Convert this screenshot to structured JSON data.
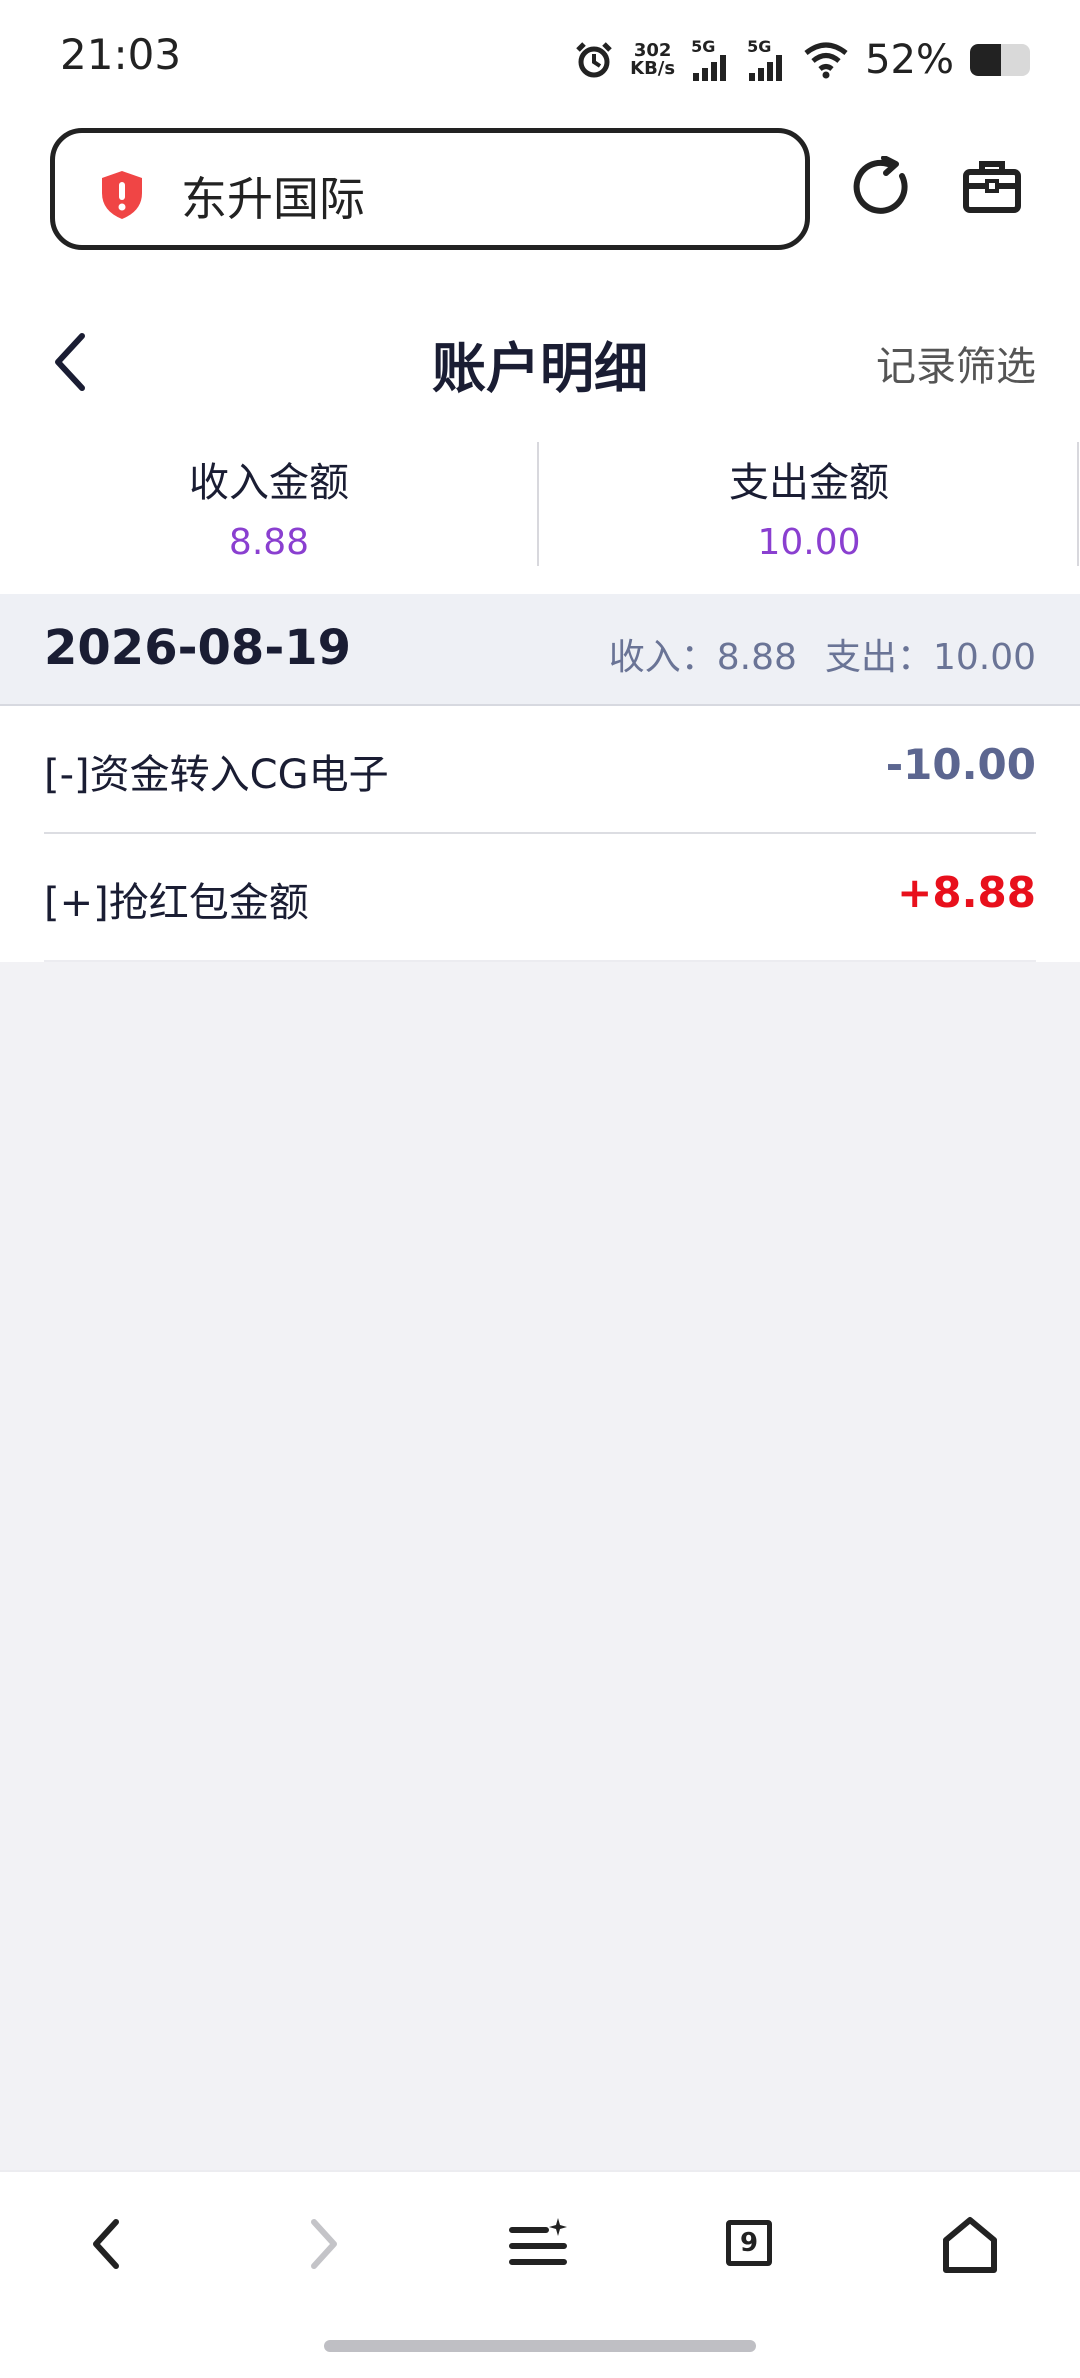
{
  "status_bar": {
    "time": "21:03",
    "net_speed_value": "302",
    "net_speed_unit": "KB/s",
    "sim1": "5G",
    "sim2": "5G",
    "battery_percent": "52%"
  },
  "browser": {
    "url_title": "东升国际",
    "icons": [
      "warning-shield-icon",
      "reload-icon",
      "toolbox-icon"
    ]
  },
  "header": {
    "title": "账户明细",
    "filter_label": "记录筛选"
  },
  "summary": {
    "income_label": "收入金额",
    "income_value": "8.88",
    "expense_label": "支出金额",
    "expense_value": "10.00"
  },
  "group": {
    "date": "2026-08-19",
    "income_text": "收入：8.88",
    "expense_text": "支出：10.00"
  },
  "records": [
    {
      "title": "[-]资金转入CG电子",
      "amount": "-10.00",
      "type": "negative"
    },
    {
      "title": "[+]抢红包金额",
      "amount": "+8.88",
      "type": "positive"
    }
  ],
  "bottom_nav": {
    "tab_count": "9",
    "icons": [
      "back-icon",
      "forward-icon",
      "menu-icon",
      "tabs-icon",
      "home-icon"
    ]
  },
  "colors": {
    "accent_purple": "#8a3fd0",
    "negative_amount": "#5c6690",
    "positive_amount": "#e8101c",
    "shield_red": "#f04545"
  }
}
